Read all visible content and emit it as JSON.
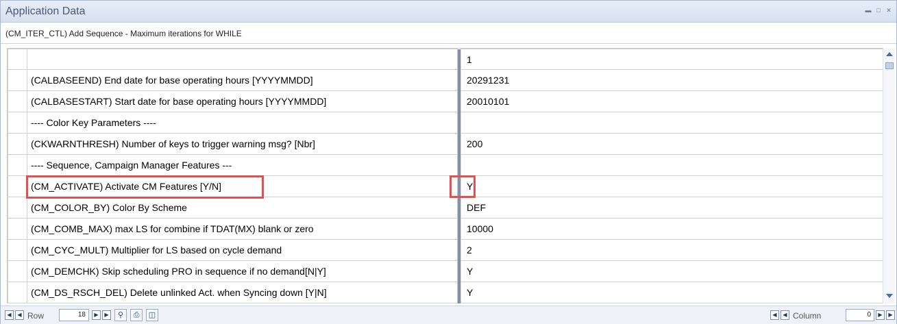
{
  "window": {
    "title": "Application Data",
    "controls": [
      "minimize-icon",
      "maximize-icon",
      "close-icon"
    ]
  },
  "description": "(CM_ITER_CTL) Add Sequence - Maximum iterations for WHILE",
  "grid": {
    "column_header": "1",
    "rows": [
      {
        "param": "(CALBASEEND) End date for base operating hours [YYYYMMDD]",
        "value": "20291231"
      },
      {
        "param": "(CALBASESTART) Start date for base operating hours [YYYYMMDD]",
        "value": "20010101"
      },
      {
        "param": "---- Color Key Parameters ----",
        "value": ""
      },
      {
        "param": "(CKWARNTHRESH) Number of keys to trigger warning msg? [Nbr]",
        "value": "200"
      },
      {
        "param": "---- Sequence, Campaign Manager Features ---",
        "value": ""
      },
      {
        "param": "(CM_ACTIVATE) Activate CM Features [Y/N]",
        "value": "Y"
      },
      {
        "param": "(CM_COLOR_BY) Color By Scheme",
        "value": "DEF"
      },
      {
        "param": "(CM_COMB_MAX) max LS for combine if TDAT(MX) blank or zero",
        "value": "10000"
      },
      {
        "param": "(CM_CYC_MULT) Multiplier for LS based on cycle demand",
        "value": "2"
      },
      {
        "param": "(CM_DEMCHK) Skip scheduling PRO in sequence if no demand[N|Y]",
        "value": "Y"
      },
      {
        "param": "(CM_DS_RSCH_DEL) Delete unlinked Act. when Syncing down [Y|N]",
        "value": "Y"
      }
    ]
  },
  "statusbar": {
    "row_label": "Row",
    "row_value": "18",
    "column_label": "Column",
    "column_value": "0",
    "icons": [
      "first-icon",
      "prev-icon",
      "next-icon",
      "last-icon",
      "find-icon",
      "print-icon",
      "export-icon"
    ]
  },
  "colors": {
    "highlight": "#e05252",
    "title_text": "#4a5a73",
    "separator": "#8492a6"
  }
}
